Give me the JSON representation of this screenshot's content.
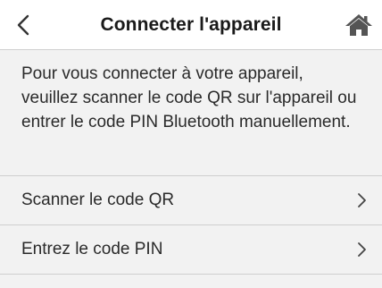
{
  "header": {
    "title": "Connecter l'appareil",
    "back_icon": "chevron-left-icon",
    "home_icon": "home-icon"
  },
  "description": "Pour vous connecter à votre appareil, veuillez scanner le code QR sur l'appareil ou entrer le code PIN Bluetooth manuellement.",
  "menu": {
    "items": [
      {
        "label": "Scanner le code QR",
        "icon": "chevron-right-icon"
      },
      {
        "label": "Entrez le code PIN",
        "icon": "chevron-right-icon"
      }
    ]
  },
  "colors": {
    "header_bg": "#ffffff",
    "page_bg": "#f2f2f2",
    "divider": "#cfcfcf",
    "text": "#1a1a1a",
    "icon": "#555555"
  }
}
